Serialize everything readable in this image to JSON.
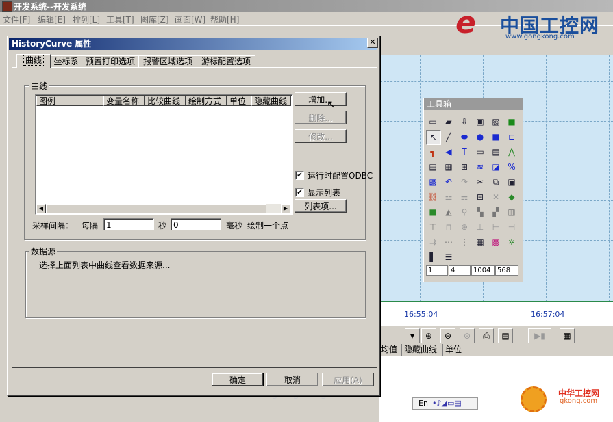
{
  "app": {
    "title": "开发系统--开发系统",
    "menus": [
      "文件[F]",
      "编辑[E]",
      "排列[L]",
      "工具[T]",
      "图库[Z]",
      "画面[W]",
      "帮助[H]"
    ]
  },
  "logo": {
    "brand": "中国工控网",
    "url": "www.gongkong.com",
    "mark": "e"
  },
  "canvas": {
    "times": [
      "16:55:04",
      "16:57:04"
    ]
  },
  "bottom_table": {
    "headers": [
      "均值",
      "隐藏曲线",
      "单位"
    ]
  },
  "ime": {
    "label": "En"
  },
  "watermark": "www.gongkong.com",
  "brand2": {
    "name": "中华工控网",
    "url": "gkong.com"
  },
  "toolbox": {
    "title": "工具箱",
    "fields": [
      "1",
      "4",
      "1004",
      "568"
    ]
  },
  "dialog": {
    "title": "HistoryCurve 属性",
    "close": "✕",
    "tabs": [
      "曲线",
      "坐标系",
      "预置打印选项",
      "报警区域选项",
      "游标配置选项"
    ],
    "curve_group": "曲线",
    "columns": [
      "图例",
      "变量名称",
      "比较曲线",
      "绘制方式",
      "单位",
      "隐藏曲线"
    ],
    "buttons": {
      "add": "增加...",
      "delete": "删除...",
      "modify": "修改...",
      "list_items": "列表项..."
    },
    "checkboxes": [
      {
        "label": "运行时配置ODBC",
        "checked": true
      },
      {
        "label": "显示列表",
        "checked": true
      }
    ],
    "sampling": {
      "label": "采样间隔：",
      "every": "每隔",
      "seconds_value": "1",
      "seconds_unit": "秒",
      "ms_value": "0",
      "ms_unit": "毫秒",
      "suffix": "绘制一个点"
    },
    "datasource": {
      "label": "数据源",
      "text": "选择上面列表中曲线查看数据来源..."
    },
    "footer": {
      "ok": "确定",
      "cancel": "取消",
      "apply": "应用(A)"
    }
  }
}
